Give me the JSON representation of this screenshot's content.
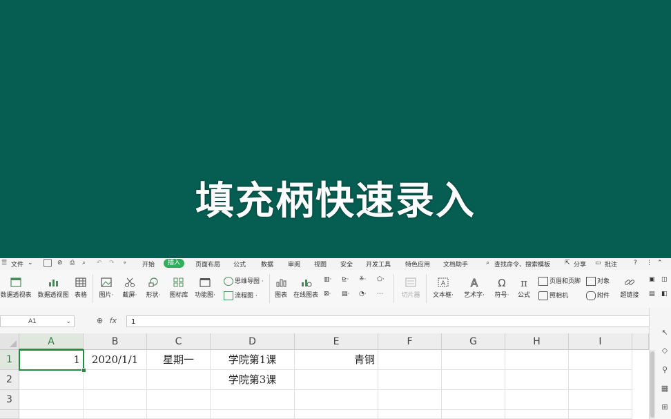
{
  "banner": {
    "title": "填充柄快速录入",
    "bg": "#065e52"
  },
  "menu": {
    "file": "文件",
    "tabs": [
      "开始",
      "插入",
      "页面布局",
      "公式",
      "数据",
      "审阅",
      "视图",
      "安全",
      "开发工具",
      "特色应用",
      "文档助手"
    ],
    "active_tab": "插入",
    "search": "查找命令、搜索模板",
    "share": "分享",
    "comment": "批注",
    "help": "?"
  },
  "ribbon": {
    "pivot_table": "数据透视表",
    "pivot_chart": "数据透视图",
    "table": "表格",
    "picture": "图片",
    "screenshot": "截屏",
    "shapes": "形状",
    "icon_lib": "图标库",
    "func_chart": "功能图",
    "mind_map": "思维导图",
    "flowchart": "流程图",
    "chart": "图表",
    "online_chart": "在线图表",
    "slicer": "切片器",
    "textbox": "文本框",
    "wordart": "艺术字",
    "symbol": "符号",
    "formula": "公式",
    "header_footer": "页眉和页脚",
    "camera": "照相机",
    "object": "对象",
    "attachment": "附件",
    "hyperlink": "超链接"
  },
  "formula_bar": {
    "cell_ref": "A1",
    "fx": "fx",
    "value": "1"
  },
  "sheet": {
    "columns": [
      "A",
      "B",
      "C",
      "D",
      "E",
      "F",
      "G",
      "H",
      "I"
    ],
    "rows": [
      "1",
      "2",
      "3"
    ],
    "cells": {
      "A1": "1",
      "B1": "2020/1/1",
      "C1": "星期一",
      "D1": "学院第1课",
      "E1": "青铜",
      "D2": "学院第3课"
    }
  },
  "colors": {
    "accent": "#1e8e3e",
    "active_tab": "#2fae5c"
  }
}
